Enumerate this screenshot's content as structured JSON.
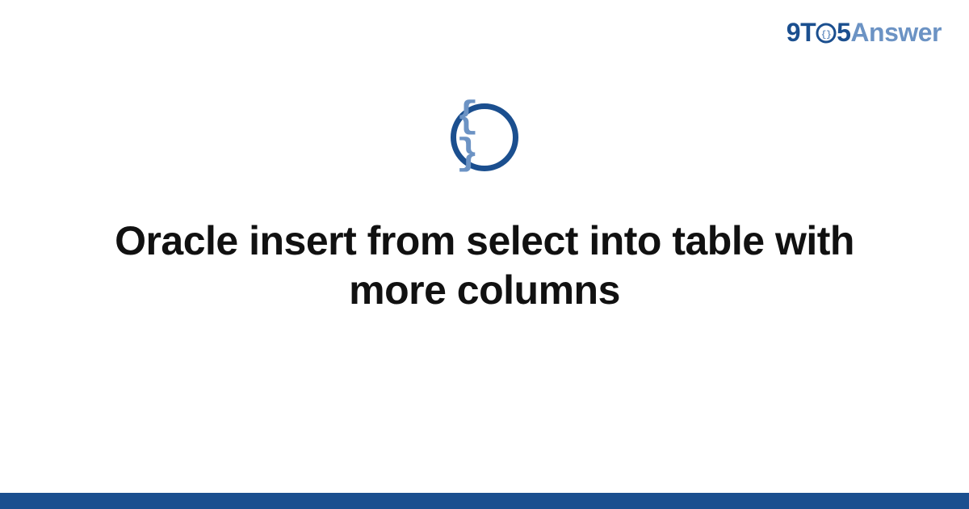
{
  "brand": {
    "nine": "9",
    "t": "T",
    "five": "5",
    "answer": "Answer"
  },
  "badge": {
    "glyph": "{ }"
  },
  "main": {
    "title": "Oracle insert from select into table with more columns"
  },
  "colors": {
    "primary": "#1b4f8f",
    "accent": "#6c93c4"
  }
}
